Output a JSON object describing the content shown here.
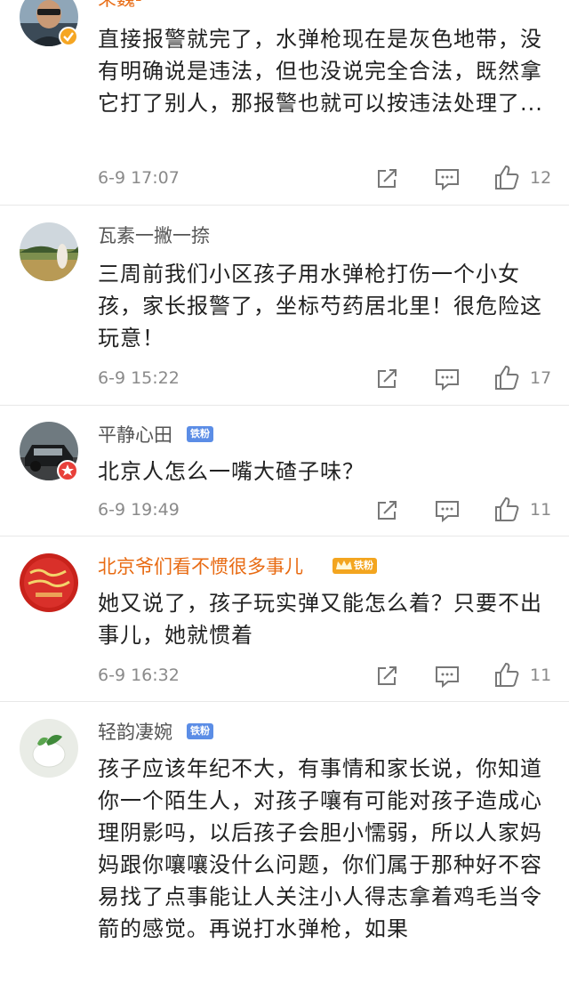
{
  "comments": [
    {
      "name": "朵巍-",
      "text": "直接报警就完了，水弹枪现在是灰色地带，没有明确说是违法，但也没说完全合法，既然拿它打了别人，那报警也就可以按违法处理了...",
      "time": "6-9 17:07",
      "likes": "12"
    },
    {
      "name": "瓦素一撇一捺",
      "text": "三周前我们小区孩子用水弹枪打伤一个小女孩，家长报警了，坐标芍药居北里！很危险这玩意！",
      "time": "6-9 15:22",
      "likes": "17"
    },
    {
      "name": "平静心田",
      "badge": "铁粉",
      "text": "北京人怎么一嘴大碴子味？",
      "time": "6-9 19:49",
      "likes": "11"
    },
    {
      "name": "北京爷们看不惯很多事儿",
      "badge": "铁粉",
      "text": "她又说了，孩子玩实弹又能怎么着？只要不出事儿，她就惯着",
      "time": "6-9 16:32",
      "likes": "11"
    },
    {
      "name": "轻韵凄婉",
      "badge": "铁粉",
      "text": "孩子应该年纪不大，有事情和家长说，你知道你一个陌生人，对孩子嚷有可能对孩子造成心理阴影吗，以后孩子会胆小懦弱，所以人家妈妈跟你嚷嚷没什么问题，你们属于那种好不容易找了点事能让人关注小人得志拿着鸡毛当令箭的感觉。再说打水弹枪，如果"
    }
  ],
  "colors": {
    "accent_vip": "#e86b13",
    "fan_badge": "#5b8de6",
    "meta_gray": "#8a8a8a"
  },
  "icons": [
    "share-icon",
    "comment-icon",
    "like-icon"
  ]
}
